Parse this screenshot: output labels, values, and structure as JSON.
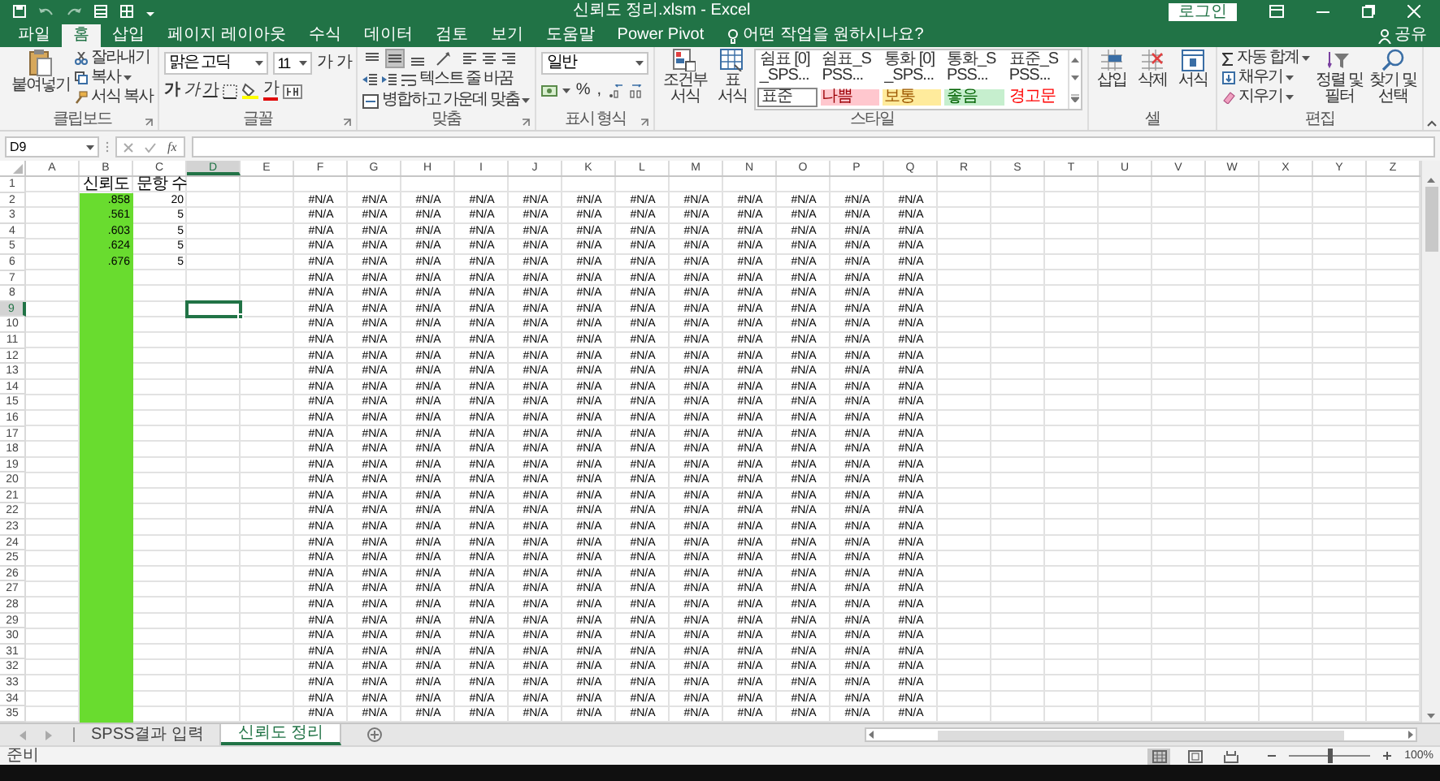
{
  "title_bar": {
    "title": "신뢰도 정리.xlsm - Excel",
    "sign_in": "로그인"
  },
  "tabs": [
    {
      "label": "파일",
      "selected": false
    },
    {
      "label": "홈",
      "selected": true
    },
    {
      "label": "삽입",
      "selected": false
    },
    {
      "label": "페이지 레이아웃",
      "selected": false
    },
    {
      "label": "수식",
      "selected": false
    },
    {
      "label": "데이터",
      "selected": false
    },
    {
      "label": "검토",
      "selected": false
    },
    {
      "label": "보기",
      "selected": false
    },
    {
      "label": "도움말",
      "selected": false
    },
    {
      "label": "Power Pivot",
      "selected": false
    }
  ],
  "tell_me": {
    "placeholder": "어떤 작업을 원하시나요?"
  },
  "share": "공유",
  "ribbon": {
    "clipboard": {
      "label": "클립보드",
      "paste": "붙여넣기",
      "cut": "잘라내기",
      "copy": "복사",
      "format_painter": "서식 복사"
    },
    "font": {
      "label": "글꼴",
      "font_name": "맑은 고딕",
      "font_size": "11",
      "grow": "가",
      "shrink": "가",
      "bold": "가",
      "italic": "가",
      "underline": "가",
      "font_color": "가"
    },
    "alignment": {
      "label": "맞춤",
      "vertical_align": [
        {
          "selected": false
        },
        {
          "selected": true
        },
        {
          "selected": false
        }
      ],
      "wrap_text": "텍스트 줄 바꿈",
      "merge_center": "병합하고 가운데 맞춤"
    },
    "number": {
      "label": "표시 형식",
      "format": "일반",
      "percent": "%",
      "comma": ","
    },
    "styles": {
      "label": "스타일",
      "conditional_formatting": "조건부 서식",
      "format_as_table": "표 서식",
      "gallery": [
        {
          "label": "쉼표 [0]_SPS...",
          "kind": "plain"
        },
        {
          "label": "쉼표_SPSS...",
          "kind": "plain"
        },
        {
          "label": "통화 [0]_SPS...",
          "kind": "plain"
        },
        {
          "label": "통화_SPSS...",
          "kind": "plain"
        },
        {
          "label": "표준_SPSS...",
          "kind": "plain"
        },
        {
          "label": "표준",
          "kind": "normal"
        },
        {
          "label": "나쁨",
          "kind": "bad"
        },
        {
          "label": "보통",
          "kind": "neutral"
        },
        {
          "label": "좋음",
          "kind": "good"
        },
        {
          "label": "경고문",
          "kind": "warning"
        }
      ]
    },
    "cells": {
      "label": "셀",
      "insert": "삽입",
      "delete": "삭제",
      "format": "서식"
    },
    "editing": {
      "label": "편집",
      "autosum": "자동 합계",
      "fill": "채우기",
      "clear": "지우기",
      "sort_filter": "정렬 및 필터",
      "find_select": "찾기 및 선택"
    }
  },
  "formula_bar": {
    "name_box": "D9",
    "insert_function": "fx"
  },
  "sheet": {
    "columns": [
      {
        "label": "A",
        "selected": false
      },
      {
        "label": "B",
        "selected": false,
        "color": "#69dc2f"
      },
      {
        "label": "C",
        "selected": false
      },
      {
        "label": "D",
        "selected": true
      },
      {
        "label": "E",
        "selected": false
      },
      {
        "label": "F",
        "selected": false
      },
      {
        "label": "G",
        "selected": false
      },
      {
        "label": "H",
        "selected": false
      },
      {
        "label": "I",
        "selected": false
      },
      {
        "label": "J",
        "selected": false
      },
      {
        "label": "K",
        "selected": false
      },
      {
        "label": "L",
        "selected": false
      },
      {
        "label": "M",
        "selected": false
      },
      {
        "label": "N",
        "selected": false
      },
      {
        "label": "O",
        "selected": false
      },
      {
        "label": "P",
        "selected": false
      },
      {
        "label": "Q",
        "selected": false
      },
      {
        "label": "R",
        "selected": false
      },
      {
        "label": "S",
        "selected": false
      },
      {
        "label": "T",
        "selected": false
      },
      {
        "label": "U",
        "selected": false
      },
      {
        "label": "V",
        "selected": false
      },
      {
        "label": "W",
        "selected": false
      },
      {
        "label": "X",
        "selected": false
      },
      {
        "label": "Y",
        "selected": false
      },
      {
        "label": "Z",
        "selected": false
      }
    ],
    "rows": [
      {
        "number": "1",
        "kind": "header",
        "selected": false,
        "cells": [
          "",
          "신뢰도",
          "문항 수"
        ]
      },
      {
        "number": "2",
        "kind": "data",
        "selected": false,
        "cells": [
          "",
          ".858",
          "20",
          "",
          "",
          "#N/A",
          "#N/A",
          "#N/A",
          "#N/A",
          "#N/A",
          "#N/A",
          "#N/A",
          "#N/A",
          "#N/A",
          "#N/A",
          "#N/A",
          "#N/A"
        ]
      },
      {
        "number": "3",
        "kind": "data",
        "selected": false,
        "cells": [
          "",
          ".561",
          "5",
          "",
          "",
          "#N/A",
          "#N/A",
          "#N/A",
          "#N/A",
          "#N/A",
          "#N/A",
          "#N/A",
          "#N/A",
          "#N/A",
          "#N/A",
          "#N/A",
          "#N/A"
        ]
      },
      {
        "number": "4",
        "kind": "data",
        "selected": false,
        "cells": [
          "",
          ".603",
          "5",
          "",
          "",
          "#N/A",
          "#N/A",
          "#N/A",
          "#N/A",
          "#N/A",
          "#N/A",
          "#N/A",
          "#N/A",
          "#N/A",
          "#N/A",
          "#N/A",
          "#N/A"
        ]
      },
      {
        "number": "5",
        "kind": "data",
        "selected": false,
        "cells": [
          "",
          ".624",
          "5",
          "",
          "",
          "#N/A",
          "#N/A",
          "#N/A",
          "#N/A",
          "#N/A",
          "#N/A",
          "#N/A",
          "#N/A",
          "#N/A",
          "#N/A",
          "#N/A",
          "#N/A"
        ]
      },
      {
        "number": "6",
        "kind": "data",
        "selected": false,
        "cells": [
          "",
          ".676",
          "5",
          "",
          "",
          "#N/A",
          "#N/A",
          "#N/A",
          "#N/A",
          "#N/A",
          "#N/A",
          "#N/A",
          "#N/A",
          "#N/A",
          "#N/A",
          "#N/A",
          "#N/A"
        ]
      },
      {
        "number": "7",
        "kind": "data",
        "selected": false,
        "cells": [
          "",
          "",
          "",
          "",
          "",
          "#N/A",
          "#N/A",
          "#N/A",
          "#N/A",
          "#N/A",
          "#N/A",
          "#N/A",
          "#N/A",
          "#N/A",
          "#N/A",
          "#N/A",
          "#N/A"
        ]
      },
      {
        "number": "8",
        "kind": "data",
        "selected": false,
        "cells": [
          "",
          "",
          "",
          "",
          "",
          "#N/A",
          "#N/A",
          "#N/A",
          "#N/A",
          "#N/A",
          "#N/A",
          "#N/A",
          "#N/A",
          "#N/A",
          "#N/A",
          "#N/A",
          "#N/A"
        ]
      },
      {
        "number": "9",
        "kind": "data",
        "selected": true,
        "cells": [
          "",
          "",
          "",
          "",
          "",
          "#N/A",
          "#N/A",
          "#N/A",
          "#N/A",
          "#N/A",
          "#N/A",
          "#N/A",
          "#N/A",
          "#N/A",
          "#N/A",
          "#N/A",
          "#N/A"
        ]
      },
      {
        "number": "10",
        "kind": "data",
        "selected": false,
        "cells": [
          "",
          "",
          "",
          "",
          "",
          "#N/A",
          "#N/A",
          "#N/A",
          "#N/A",
          "#N/A",
          "#N/A",
          "#N/A",
          "#N/A",
          "#N/A",
          "#N/A",
          "#N/A",
          "#N/A"
        ]
      },
      {
        "number": "11",
        "kind": "data",
        "selected": false,
        "cells": [
          "",
          "",
          "",
          "",
          "",
          "#N/A",
          "#N/A",
          "#N/A",
          "#N/A",
          "#N/A",
          "#N/A",
          "#N/A",
          "#N/A",
          "#N/A",
          "#N/A",
          "#N/A",
          "#N/A"
        ]
      },
      {
        "number": "12",
        "kind": "data",
        "selected": false,
        "cells": [
          "",
          "",
          "",
          "",
          "",
          "#N/A",
          "#N/A",
          "#N/A",
          "#N/A",
          "#N/A",
          "#N/A",
          "#N/A",
          "#N/A",
          "#N/A",
          "#N/A",
          "#N/A",
          "#N/A"
        ]
      },
      {
        "number": "13",
        "kind": "data",
        "selected": false,
        "cells": [
          "",
          "",
          "",
          "",
          "",
          "#N/A",
          "#N/A",
          "#N/A",
          "#N/A",
          "#N/A",
          "#N/A",
          "#N/A",
          "#N/A",
          "#N/A",
          "#N/A",
          "#N/A",
          "#N/A"
        ]
      },
      {
        "number": "14",
        "kind": "data",
        "selected": false,
        "cells": [
          "",
          "",
          "",
          "",
          "",
          "#N/A",
          "#N/A",
          "#N/A",
          "#N/A",
          "#N/A",
          "#N/A",
          "#N/A",
          "#N/A",
          "#N/A",
          "#N/A",
          "#N/A",
          "#N/A"
        ]
      },
      {
        "number": "15",
        "kind": "data",
        "selected": false,
        "cells": [
          "",
          "",
          "",
          "",
          "",
          "#N/A",
          "#N/A",
          "#N/A",
          "#N/A",
          "#N/A",
          "#N/A",
          "#N/A",
          "#N/A",
          "#N/A",
          "#N/A",
          "#N/A",
          "#N/A"
        ]
      },
      {
        "number": "16",
        "kind": "data",
        "selected": false,
        "cells": [
          "",
          "",
          "",
          "",
          "",
          "#N/A",
          "#N/A",
          "#N/A",
          "#N/A",
          "#N/A",
          "#N/A",
          "#N/A",
          "#N/A",
          "#N/A",
          "#N/A",
          "#N/A",
          "#N/A"
        ]
      },
      {
        "number": "17",
        "kind": "data",
        "selected": false,
        "cells": [
          "",
          "",
          "",
          "",
          "",
          "#N/A",
          "#N/A",
          "#N/A",
          "#N/A",
          "#N/A",
          "#N/A",
          "#N/A",
          "#N/A",
          "#N/A",
          "#N/A",
          "#N/A",
          "#N/A"
        ]
      },
      {
        "number": "18",
        "kind": "data",
        "selected": false,
        "cells": [
          "",
          "",
          "",
          "",
          "",
          "#N/A",
          "#N/A",
          "#N/A",
          "#N/A",
          "#N/A",
          "#N/A",
          "#N/A",
          "#N/A",
          "#N/A",
          "#N/A",
          "#N/A",
          "#N/A"
        ]
      },
      {
        "number": "19",
        "kind": "data",
        "selected": false,
        "cells": [
          "",
          "",
          "",
          "",
          "",
          "#N/A",
          "#N/A",
          "#N/A",
          "#N/A",
          "#N/A",
          "#N/A",
          "#N/A",
          "#N/A",
          "#N/A",
          "#N/A",
          "#N/A",
          "#N/A"
        ]
      },
      {
        "number": "20",
        "kind": "data",
        "selected": false,
        "cells": [
          "",
          "",
          "",
          "",
          "",
          "#N/A",
          "#N/A",
          "#N/A",
          "#N/A",
          "#N/A",
          "#N/A",
          "#N/A",
          "#N/A",
          "#N/A",
          "#N/A",
          "#N/A",
          "#N/A"
        ]
      },
      {
        "number": "21",
        "kind": "data",
        "selected": false,
        "cells": [
          "",
          "",
          "",
          "",
          "",
          "#N/A",
          "#N/A",
          "#N/A",
          "#N/A",
          "#N/A",
          "#N/A",
          "#N/A",
          "#N/A",
          "#N/A",
          "#N/A",
          "#N/A",
          "#N/A"
        ]
      },
      {
        "number": "22",
        "kind": "data",
        "selected": false,
        "cells": [
          "",
          "",
          "",
          "",
          "",
          "#N/A",
          "#N/A",
          "#N/A",
          "#N/A",
          "#N/A",
          "#N/A",
          "#N/A",
          "#N/A",
          "#N/A",
          "#N/A",
          "#N/A",
          "#N/A"
        ]
      },
      {
        "number": "23",
        "kind": "data",
        "selected": false,
        "cells": [
          "",
          "",
          "",
          "",
          "",
          "#N/A",
          "#N/A",
          "#N/A",
          "#N/A",
          "#N/A",
          "#N/A",
          "#N/A",
          "#N/A",
          "#N/A",
          "#N/A",
          "#N/A",
          "#N/A"
        ]
      },
      {
        "number": "24",
        "kind": "data",
        "selected": false,
        "cells": [
          "",
          "",
          "",
          "",
          "",
          "#N/A",
          "#N/A",
          "#N/A",
          "#N/A",
          "#N/A",
          "#N/A",
          "#N/A",
          "#N/A",
          "#N/A",
          "#N/A",
          "#N/A",
          "#N/A"
        ]
      },
      {
        "number": "25",
        "kind": "data",
        "selected": false,
        "cells": [
          "",
          "",
          "",
          "",
          "",
          "#N/A",
          "#N/A",
          "#N/A",
          "#N/A",
          "#N/A",
          "#N/A",
          "#N/A",
          "#N/A",
          "#N/A",
          "#N/A",
          "#N/A",
          "#N/A"
        ]
      },
      {
        "number": "26",
        "kind": "data",
        "selected": false,
        "cells": [
          "",
          "",
          "",
          "",
          "",
          "#N/A",
          "#N/A",
          "#N/A",
          "#N/A",
          "#N/A",
          "#N/A",
          "#N/A",
          "#N/A",
          "#N/A",
          "#N/A",
          "#N/A",
          "#N/A"
        ]
      },
      {
        "number": "27",
        "kind": "data",
        "selected": false,
        "cells": [
          "",
          "",
          "",
          "",
          "",
          "#N/A",
          "#N/A",
          "#N/A",
          "#N/A",
          "#N/A",
          "#N/A",
          "#N/A",
          "#N/A",
          "#N/A",
          "#N/A",
          "#N/A",
          "#N/A"
        ]
      },
      {
        "number": "28",
        "kind": "data",
        "selected": false,
        "cells": [
          "",
          "",
          "",
          "",
          "",
          "#N/A",
          "#N/A",
          "#N/A",
          "#N/A",
          "#N/A",
          "#N/A",
          "#N/A",
          "#N/A",
          "#N/A",
          "#N/A",
          "#N/A",
          "#N/A"
        ]
      },
      {
        "number": "29",
        "kind": "data",
        "selected": false,
        "cells": [
          "",
          "",
          "",
          "",
          "",
          "#N/A",
          "#N/A",
          "#N/A",
          "#N/A",
          "#N/A",
          "#N/A",
          "#N/A",
          "#N/A",
          "#N/A",
          "#N/A",
          "#N/A",
          "#N/A"
        ]
      },
      {
        "number": "30",
        "kind": "data",
        "selected": false,
        "cells": [
          "",
          "",
          "",
          "",
          "",
          "#N/A",
          "#N/A",
          "#N/A",
          "#N/A",
          "#N/A",
          "#N/A",
          "#N/A",
          "#N/A",
          "#N/A",
          "#N/A",
          "#N/A",
          "#N/A"
        ]
      },
      {
        "number": "31",
        "kind": "data",
        "selected": false,
        "cells": [
          "",
          "",
          "",
          "",
          "",
          "#N/A",
          "#N/A",
          "#N/A",
          "#N/A",
          "#N/A",
          "#N/A",
          "#N/A",
          "#N/A",
          "#N/A",
          "#N/A",
          "#N/A",
          "#N/A"
        ]
      },
      {
        "number": "32",
        "kind": "data",
        "selected": false,
        "cells": [
          "",
          "",
          "",
          "",
          "",
          "#N/A",
          "#N/A",
          "#N/A",
          "#N/A",
          "#N/A",
          "#N/A",
          "#N/A",
          "#N/A",
          "#N/A",
          "#N/A",
          "#N/A",
          "#N/A"
        ]
      },
      {
        "number": "33",
        "kind": "data",
        "selected": false,
        "cells": [
          "",
          "",
          "",
          "",
          "",
          "#N/A",
          "#N/A",
          "#N/A",
          "#N/A",
          "#N/A",
          "#N/A",
          "#N/A",
          "#N/A",
          "#N/A",
          "#N/A",
          "#N/A",
          "#N/A"
        ]
      },
      {
        "number": "34",
        "kind": "data",
        "selected": false,
        "cells": [
          "",
          "",
          "",
          "",
          "",
          "#N/A",
          "#N/A",
          "#N/A",
          "#N/A",
          "#N/A",
          "#N/A",
          "#N/A",
          "#N/A",
          "#N/A",
          "#N/A",
          "#N/A",
          "#N/A"
        ]
      },
      {
        "number": "35",
        "kind": "data",
        "selected": false,
        "cells": [
          "",
          "",
          "",
          "",
          "",
          "#N/A",
          "#N/A",
          "#N/A",
          "#N/A",
          "#N/A",
          "#N/A",
          "#N/A",
          "#N/A",
          "#N/A",
          "#N/A",
          "#N/A",
          "#N/A"
        ]
      }
    ]
  },
  "sheet_tabs": [
    {
      "label": "SPSS결과 입력",
      "selected": false
    },
    {
      "label": "신뢰도 정리",
      "selected": true
    }
  ],
  "status_bar": {
    "status": "준비",
    "views": [
      {
        "kind": "normal",
        "selected": true
      },
      {
        "kind": "page_layout",
        "selected": false
      },
      {
        "kind": "page_break",
        "selected": false
      }
    ],
    "zoom_slider": {
      "level": 0.5
    },
    "zoom": "100%"
  }
}
